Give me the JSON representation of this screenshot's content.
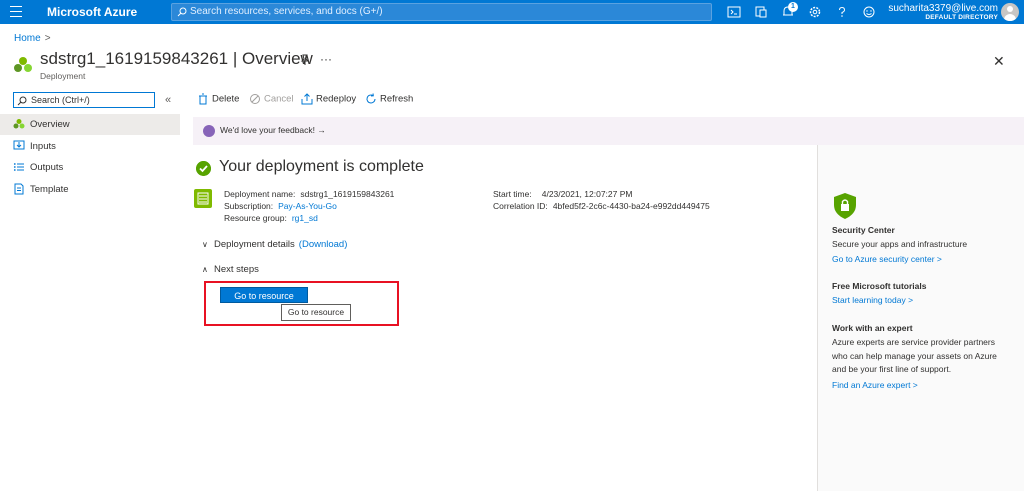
{
  "topbar": {
    "brand": "Microsoft Azure",
    "search_placeholder": "Search resources, services, and docs (G+/)",
    "notifications_count": "1",
    "user_email": "sucharita3379@live.com",
    "user_directory": "DEFAULT DIRECTORY",
    "icons": [
      "menu-icon",
      "cloud-shell-icon",
      "directory-filter-icon",
      "notifications-icon",
      "settings-icon",
      "help-icon",
      "feedback-icon"
    ]
  },
  "breadcrumb": {
    "home": "Home",
    "separator": ">"
  },
  "header": {
    "title": "sdstrg1_1619159843261 | Overview",
    "subtitle": "Deployment"
  },
  "sidebar": {
    "search_placeholder": "Search (Ctrl+/)",
    "collapse": "«",
    "items": [
      {
        "label": "Overview",
        "icon": "overview-icon",
        "active": true
      },
      {
        "label": "Inputs",
        "icon": "inputs-icon"
      },
      {
        "label": "Outputs",
        "icon": "outputs-icon"
      },
      {
        "label": "Template",
        "icon": "template-icon"
      }
    ]
  },
  "commands": {
    "delete": "Delete",
    "cancel": "Cancel",
    "redeploy": "Redeploy",
    "refresh": "Refresh"
  },
  "feedback": {
    "text": "We'd love your feedback!",
    "arrow": "→"
  },
  "deployment": {
    "status": "Your deployment is complete",
    "name_label": "Deployment name:",
    "name_value": "sdstrg1_1619159843261",
    "subscription_label": "Subscription:",
    "subscription_value": "Pay-As-You-Go",
    "resource_group_label": "Resource group:",
    "resource_group_value": "rg1_sd",
    "start_time_label": "Start time:",
    "start_time_value": "4/23/2021, 12:07:27 PM",
    "correlation_label": "Correlation ID:",
    "correlation_value": "4bfed5f2-2c6c-4430-ba24-e992dd449475",
    "details_label": "Deployment details",
    "download_label": "(Download)",
    "next_steps_label": "Next steps",
    "go_to_resource": "Go to resource",
    "tooltip": "Go to resource"
  },
  "right_panel": {
    "security_title": "Security Center",
    "security_text": "Secure your apps and infrastructure",
    "security_link": "Go to Azure security center >",
    "tutorials_title": "Free Microsoft tutorials",
    "tutorials_link": "Start learning today >",
    "expert_title": "Work with an expert",
    "expert_text": "Azure experts are service provider partners who can help manage your assets on Azure and be your first line of support.",
    "expert_link": "Find an Azure expert >"
  },
  "colors": {
    "accent": "#0078d4",
    "success": "#57a300",
    "highlight": "#e81123"
  }
}
